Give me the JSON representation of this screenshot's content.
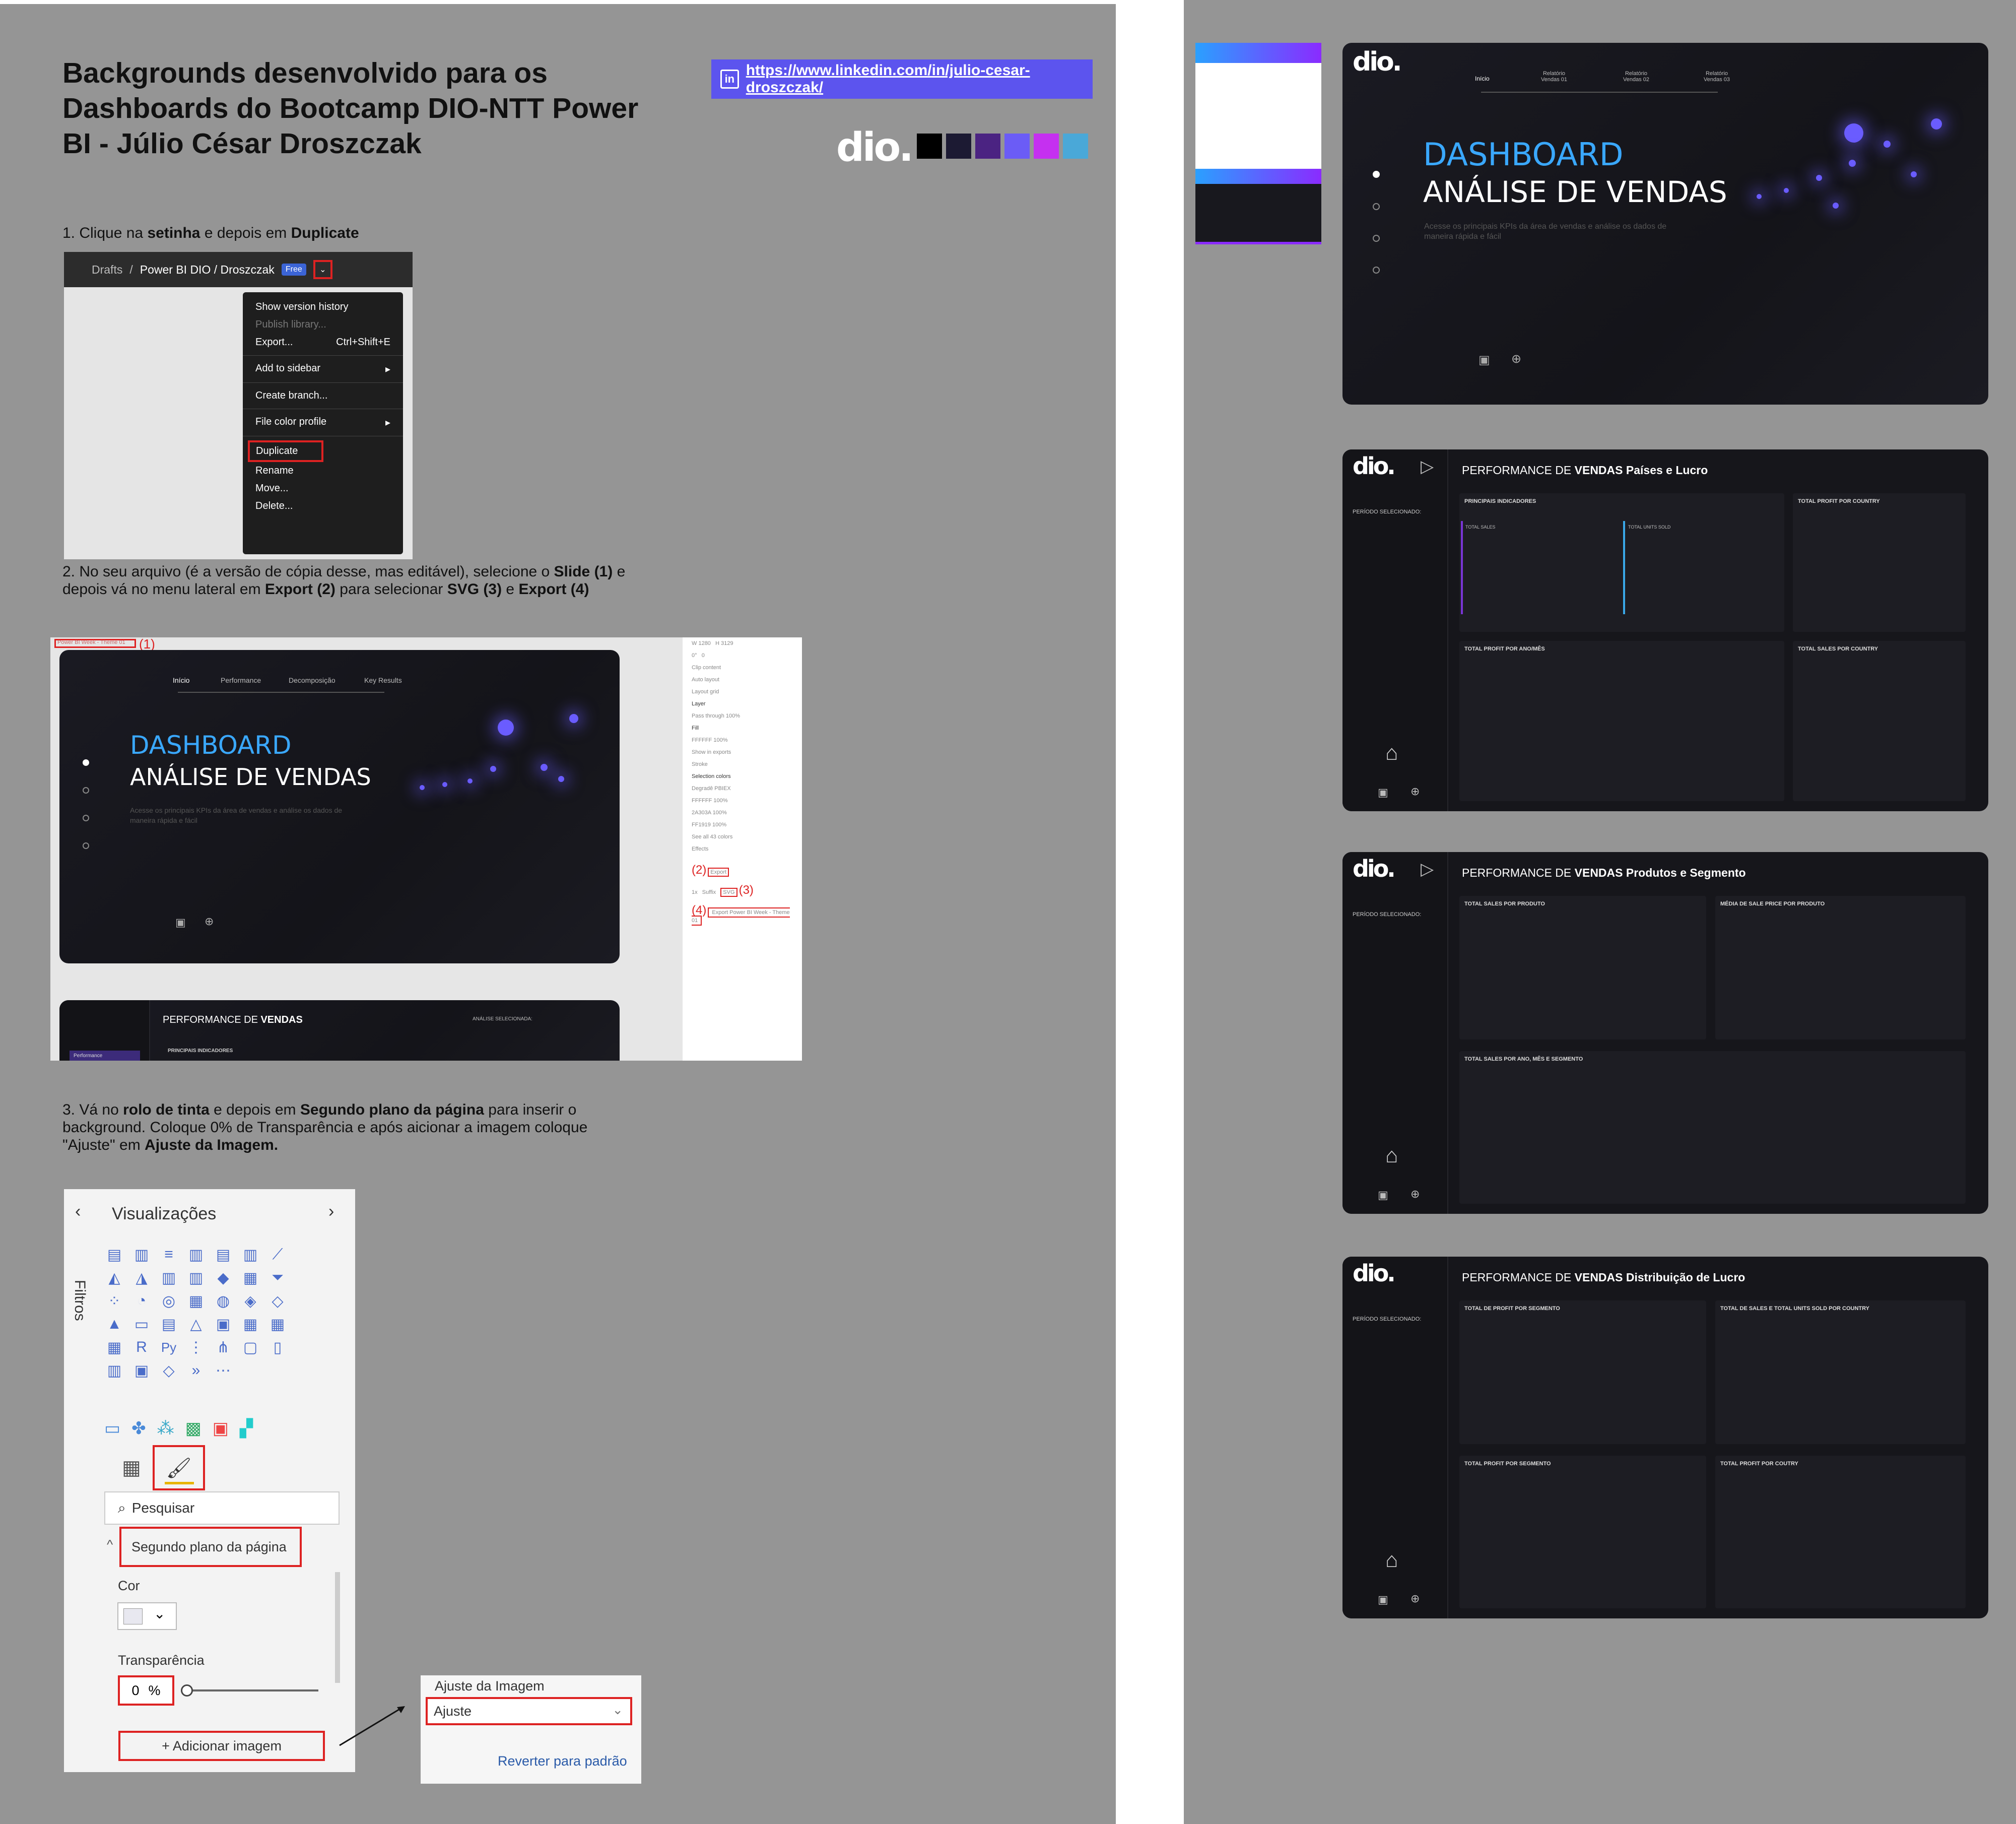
{
  "header": {
    "title": "Backgrounds desenvolvido para os Dashboards do Bootcamp DIO-NTT Power BI - Júlio César Droszczak",
    "link": "https://www.linkedin.com/in/julio-cesar-droszczak/",
    "logo": "dio."
  },
  "palette": [
    "#000000",
    "#1c1a33",
    "#4b2382",
    "#6b5cf6",
    "#c530f0",
    "#4aa8d8"
  ],
  "steps": {
    "s1_pre": "1. Clique na ",
    "s1_b1": "setinha",
    "s1_mid": " e depois em ",
    "s1_b2": "Duplicate",
    "s2_a": "2. No seu arquivo (é a versão de cópia desse, mas editável), selecione o ",
    "s2_b1": "Slide (1)",
    "s2_c": " e depois vá no menu lateral em ",
    "s2_b2": "Export (2)",
    "s2_d": "  para selecionar ",
    "s2_b3": "SVG (3)",
    "s2_e": " e ",
    "s2_b4": "Export (4)",
    "s3_a": "3. Vá no ",
    "s3_b1": "rolo de tinta",
    "s3_c": " e depois em ",
    "s3_b2": "Segundo plano da página",
    "s3_d": " para inserir o background. Coloque 0% de Transparência e após aicionar a imagem coloque \"Ajuste\" em ",
    "s3_b3": "Ajuste da Imagem."
  },
  "figma_menu": {
    "crumb": "Drafts",
    "sep": "/",
    "project": "Power BI DIO / Droszczak",
    "badge": "Free",
    "chevron": "⌄",
    "items": {
      "version": "Show version history",
      "publish": "Publish library...",
      "export": "Export...",
      "export_shortcut": "Ctrl+Shift+E",
      "sidebar": "Add to sidebar",
      "branch": "Create branch...",
      "color": "File color profile",
      "duplicate": "Duplicate",
      "rename": "Rename",
      "move": "Move...",
      "delete": "Delete..."
    }
  },
  "figma_export": {
    "frame_label": "Power BI Week - Theme 01",
    "num1": "(1)",
    "num2": "(2)",
    "num3": "(3)",
    "num4": "(4)",
    "nav": [
      "Início",
      "Performance",
      "Decomposição",
      "Key Results"
    ],
    "perf_title_a": "PERFORMANCE DE ",
    "perf_title_b": "VENDAS",
    "analise": "ANÁLISE SELECIONADA:",
    "principais": "PRINCIPAIS INDICADORES",
    "performance_tab": "Performance",
    "props": {
      "w": "W",
      "w_val": "1280",
      "h": "H",
      "h_val": "3129",
      "rot": "0°",
      "radius": "0",
      "clip": "Clip content",
      "auto_layout": "Auto layout",
      "layout_grid": "Layout grid",
      "layer": "Layer",
      "pass": "Pass through",
      "pass_pct": "100%",
      "fill": "Fill",
      "fill_hex": "FFFFFF",
      "fill_pct": "100%",
      "show_exports": "Show in exports",
      "stroke": "Stroke",
      "selection_colors": "Selection colors",
      "c1": "Degradê PBIEX",
      "c2": "FFFFFF",
      "c2_pct": "100%",
      "c3": "2A303A",
      "c3_pct": "100%",
      "c4": "FF1919",
      "c4_pct": "100%",
      "see_all": "See all 43 colors",
      "effects": "Effects",
      "export": "Export",
      "scale": "1x",
      "suffix": "Suffix",
      "svg": "SVG",
      "export_btn": "Export Power BI Week - Theme 01"
    }
  },
  "slide_main": {
    "title1": "DASHBOARD",
    "title2": "ANÁLISE DE VENDAS",
    "subtitle": "Acesse os principais KPIs da área de vendas e análise os dados de maneira rápida e fácil",
    "nav": [
      "Início",
      "Relatório Vendas 01",
      "Relatório Vendas 02",
      "Relatório Vendas 03"
    ]
  },
  "slide_small": {
    "subtitle": "Acesse os principais KPIs da área de vendas e análise os dados de maneira rápida e fácil"
  },
  "pbi": {
    "title": "Visualizações",
    "filters": "Filtros",
    "search": "Pesquisar",
    "bg": "Segundo plano da página",
    "cor": "Cor",
    "transp": "Transparência",
    "transp_val": "0",
    "pct": "%",
    "add": "+ Adicionar imagem",
    "ajuste_label": "Ajuste da Imagem",
    "ajuste_val": "Ajuste",
    "reset": "Reverter para padrão"
  },
  "panels": {
    "periodo": "PERÍODO SELECIONADO:",
    "p_prefix": "PERFORMANCE DE ",
    "p_bold": "VENDAS",
    "p2": {
      "suffix": " Países e Lucro",
      "c1": "PRINCIPAIS INDICADORES",
      "c1a": "TOTAL SALES",
      "c1b": "TOTAL UNITS SOLD",
      "c2": "TOTAL PROFIT POR COUNTRY",
      "c3": "TOTAL PROFIT POR ANO/MÊS",
      "c4": "TOTAL SALES POR COUNTRY"
    },
    "p3": {
      "suffix": " Produtos e Segmento",
      "c1": "TOTAL SALES POR PRODUTO",
      "c2": "MÉDIA DE SALE PRICE POR PRODUTO",
      "c3": "TOTAL SALES POR ANO, MÊS E SEGMENTO"
    },
    "p4": {
      "suffix": " Distribuição de Lucro",
      "c1": "TOTAL DE PROFIT POR SEGMENTO",
      "c2": "TOTAL DE SALES E TOTAL UNITS SOLD POR COUNTRY",
      "c3": "TOTAL PROFIT POR SEGMENTO",
      "c4": "TOTAL PROFIT POR COUTRY"
    }
  }
}
